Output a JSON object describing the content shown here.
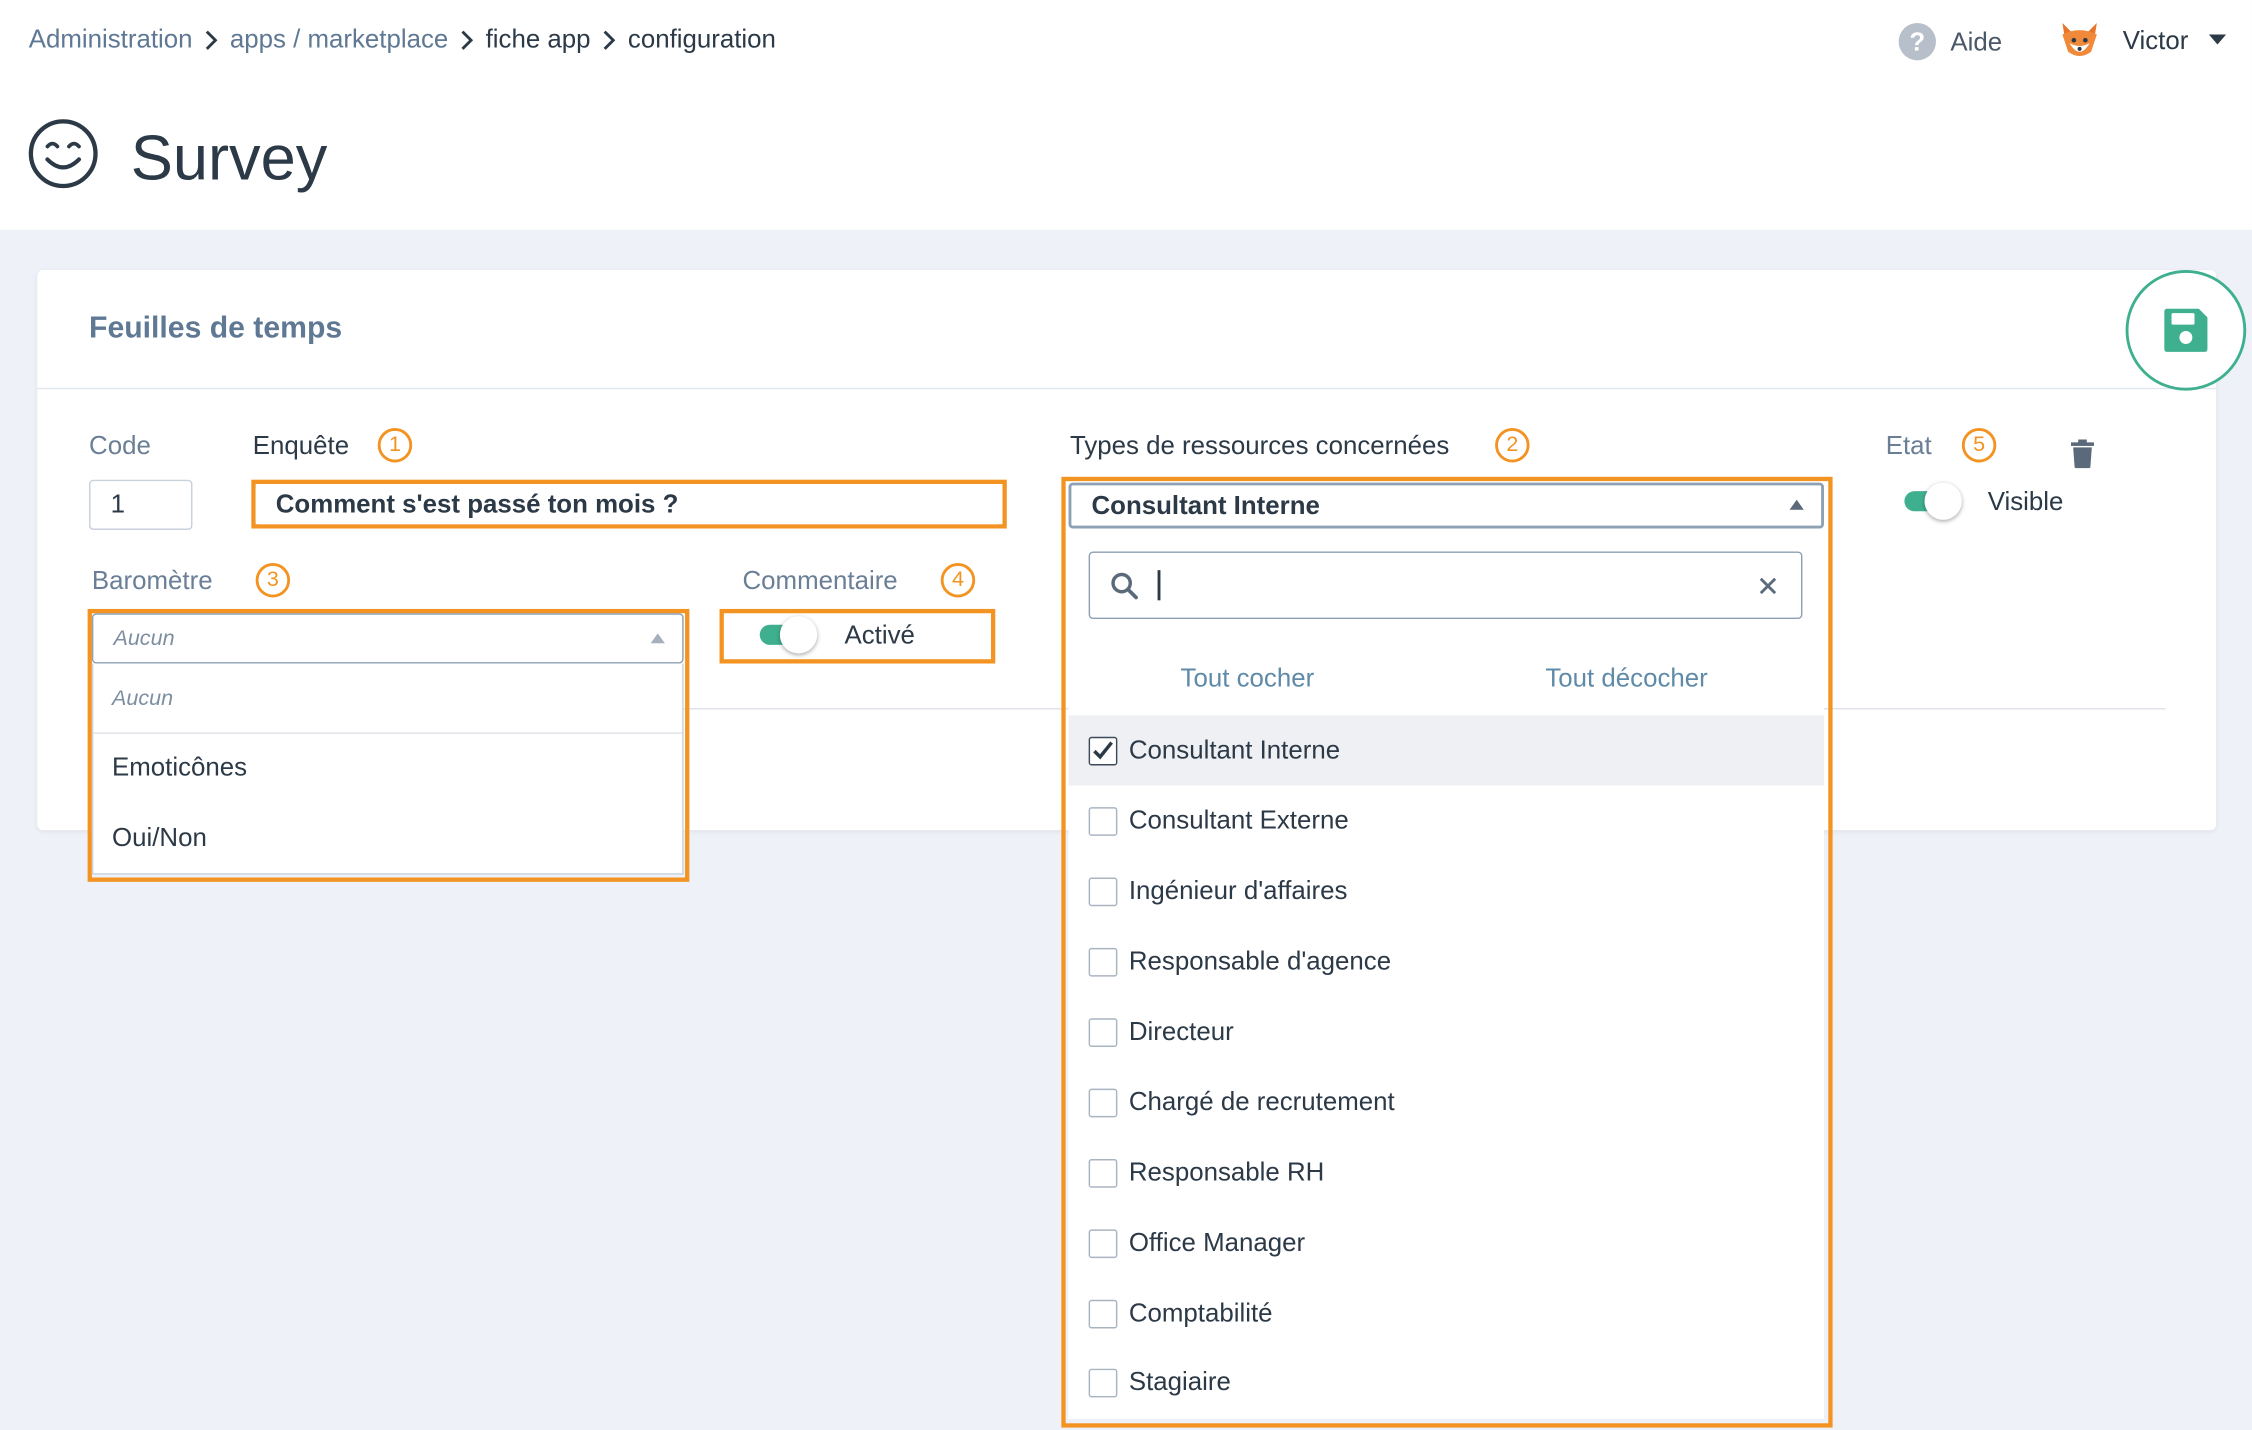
{
  "breadcrumb": {
    "items": [
      "Administration",
      "apps / marketplace",
      "fiche app",
      "configuration"
    ]
  },
  "header": {
    "help_label": "Aide",
    "user_name": "Victor",
    "page_title": "Survey"
  },
  "card": {
    "title": "Feuilles de temps"
  },
  "form": {
    "code": {
      "label": "Code",
      "value": "1"
    },
    "enquete": {
      "label": "Enquête",
      "value": "Comment s'est passé ton mois ?",
      "badge": "1"
    },
    "types": {
      "label": "Types de ressources concernées",
      "value": "Consultant Interne",
      "badge": "2"
    },
    "etat": {
      "label": "Etat",
      "toggle_label": "Visible",
      "badge": "5",
      "on": true
    },
    "barometre": {
      "label": "Baromètre",
      "value": "Aucun",
      "badge": "3",
      "options": [
        "Aucun",
        "Emoticônes",
        "Oui/Non"
      ]
    },
    "commentaire": {
      "label": "Commentaire",
      "toggle_label": "Activé",
      "badge": "4",
      "on": true
    }
  },
  "multiselect": {
    "search_value": "",
    "select_all": "Tout cocher",
    "deselect_all": "Tout décocher",
    "options": [
      {
        "label": "Consultant Interne",
        "checked": true
      },
      {
        "label": "Consultant Externe",
        "checked": false
      },
      {
        "label": "Ingénieur d'affaires",
        "checked": false
      },
      {
        "label": "Responsable d'agence",
        "checked": false
      },
      {
        "label": "Directeur",
        "checked": false
      },
      {
        "label": "Chargé de recrutement",
        "checked": false
      },
      {
        "label": "Responsable RH",
        "checked": false
      },
      {
        "label": "Office Manager",
        "checked": false
      },
      {
        "label": "Comptabilité",
        "checked": false
      },
      {
        "label": "Stagiaire",
        "checked": false
      }
    ]
  },
  "colors": {
    "accent": "#3fb08f",
    "annotation": "#f39322",
    "muted_text": "#5f7894"
  },
  "icons": [
    "chevron-right-icon",
    "help-icon",
    "fox-avatar-icon",
    "caret-down-icon",
    "smiley-icon",
    "save-icon",
    "trash-icon",
    "search-icon",
    "clear-icon",
    "checkmark-icon"
  ]
}
